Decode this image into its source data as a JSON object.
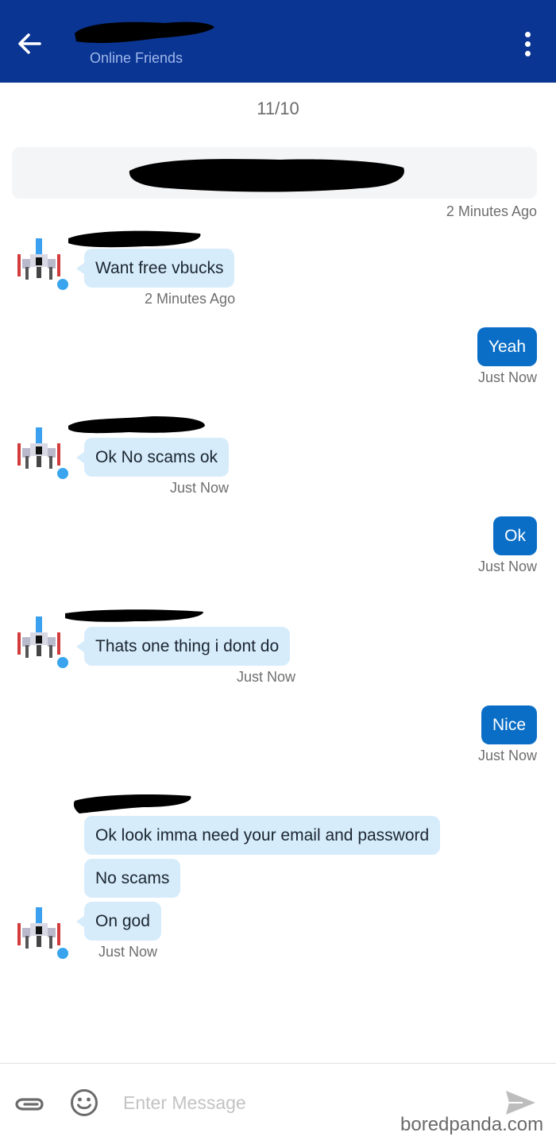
{
  "header": {
    "subtitle": "Online Friends",
    "colors": {
      "bar": "#0a3592",
      "subtitle": "#9fb7ec"
    },
    "icons": {
      "back": "arrow-left-icon",
      "menu": "more-vertical-icon"
    }
  },
  "conversation": {
    "date_separator": "11/10",
    "system_message_time": "2 Minutes Ago",
    "messages": [
      {
        "from": "friend",
        "lines": [
          "Want free vbucks"
        ],
        "time": "2 Minutes Ago"
      },
      {
        "from": "me",
        "lines": [
          "Yeah"
        ],
        "time": "Just Now"
      },
      {
        "from": "friend",
        "lines": [
          "Ok No scams ok"
        ],
        "time": "Just Now"
      },
      {
        "from": "me",
        "lines": [
          "Ok"
        ],
        "time": "Just Now"
      },
      {
        "from": "friend",
        "lines": [
          "Thats one thing i dont do"
        ],
        "time": "Just Now"
      },
      {
        "from": "me",
        "lines": [
          "Nice"
        ],
        "time": "Just Now"
      },
      {
        "from": "friend",
        "lines": [
          "Ok look imma need your email and password",
          "No scams",
          "On god"
        ],
        "time": "Just Now"
      }
    ],
    "colors": {
      "incoming_bubble": "#d6ecfb",
      "outgoing_bubble": "#0b6ec6",
      "online_dot": "#3aa5ee"
    }
  },
  "composer": {
    "placeholder": "Enter Message",
    "icons": {
      "attach": "paperclip-icon",
      "emoji": "smiley-icon",
      "send": "send-icon"
    }
  },
  "watermark": "boredpanda.com"
}
